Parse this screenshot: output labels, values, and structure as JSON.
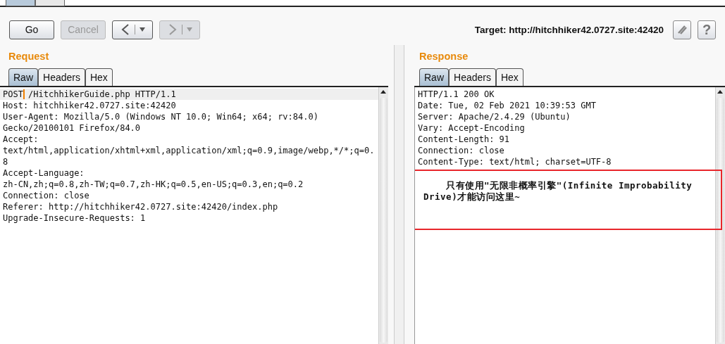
{
  "toolbar": {
    "buttons": [
      {
        "kind": "text",
        "label": "Go",
        "disabled": false
      },
      {
        "kind": "text",
        "label": "Cancel",
        "disabled": true
      },
      {
        "kind": "back",
        "disabled": false
      },
      {
        "kind": "forward",
        "disabled": true
      }
    ],
    "target": "Target: http://hitchhiker42.0727.site:42420",
    "help": "?"
  },
  "request": {
    "title": "Request",
    "tabs": [
      {
        "label": "Raw",
        "selected": true
      },
      {
        "label": "Headers",
        "selected": false
      },
      {
        "label": "Hex",
        "selected": false
      }
    ],
    "lines": [
      "POST /HitchhikerGuide.php HTTP/1.1",
      "Host: hitchhiker42.0727.site:42420",
      "User-Agent: Mozilla/5.0 (Windows NT 10.0; Win64; x64; rv:84.0)",
      "Gecko/20100101 Firefox/84.0",
      "Accept:",
      "text/html,application/xhtml+xml,application/xml;q=0.9,image/webp,*/*;q=0.",
      "8",
      "Accept-Language:",
      "zh-CN,zh;q=0.8,zh-TW;q=0.7,zh-HK;q=0.5,en-US;q=0.3,en;q=0.2",
      "Connection: close",
      "Referer: http://hitchhiker42.0727.site:42420/index.php",
      "Upgrade-Insecure-Requests: 1"
    ]
  },
  "response": {
    "title": "Response",
    "tabs": [
      {
        "label": "Raw",
        "selected": true
      },
      {
        "label": "Headers",
        "selected": false
      },
      {
        "label": "Hex",
        "selected": false
      }
    ],
    "lines": [
      "HTTP/1.1 200 OK",
      "Date: Tue, 02 Feb 2021 10:39:53 GMT",
      "Server: Apache/2.4.29 (Ubuntu)",
      "Vary: Accept-Encoding",
      "Content-Length: 91",
      "Connection: close",
      "Content-Type: text/html; charset=UTF-8"
    ],
    "body_lines": [
      "    只有使用\"无限非概率引擎\"(Infinite Improbability",
      "Drive)才能访问这里~"
    ]
  }
}
